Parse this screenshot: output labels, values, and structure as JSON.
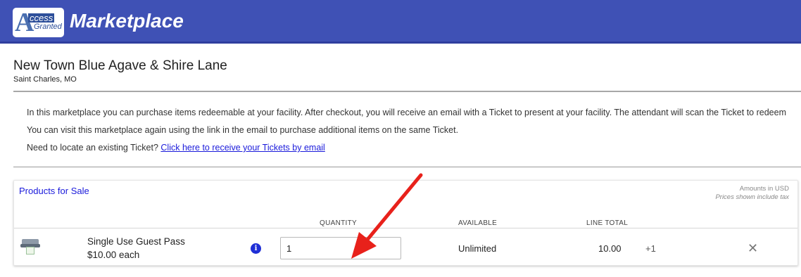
{
  "header": {
    "logo_a": "A",
    "logo_access": "ccess",
    "logo_granted": "Granted",
    "title": "Marketplace",
    "bg_color": "#3f51b5"
  },
  "venue": {
    "name": "New Town Blue Agave & Shire Lane",
    "location": "Saint Charles, MO"
  },
  "info": {
    "line1": "In this marketplace you can purchase items redeemable at your facility. After checkout, you will receive an email with a Ticket to present at your facility. The attendant will scan the Ticket to redeem",
    "line2": "You can visit this marketplace again using the link in the email to purchase additional items on the same Ticket.",
    "line3_prefix": "Need to locate an existing Ticket?",
    "line3_link": "Click here to receive your Tickets by email"
  },
  "products": {
    "title": "Products for Sale",
    "amounts_note": "Amounts in USD",
    "prices_note": "Prices shown include tax",
    "columns": {
      "quantity": "QUANTITY",
      "available": "AVAILABLE",
      "line_total": "LINE TOTAL"
    },
    "items": [
      {
        "name": "Single Use Guest Pass",
        "price": "$10.00 each",
        "info_icon": "i",
        "quantity": "1",
        "available": "Unlimited",
        "line_total": "10.00",
        "increment": "+1",
        "remove": "✕"
      }
    ]
  },
  "colors": {
    "link": "#1a1adb",
    "annotation_arrow": "#e8211b"
  }
}
